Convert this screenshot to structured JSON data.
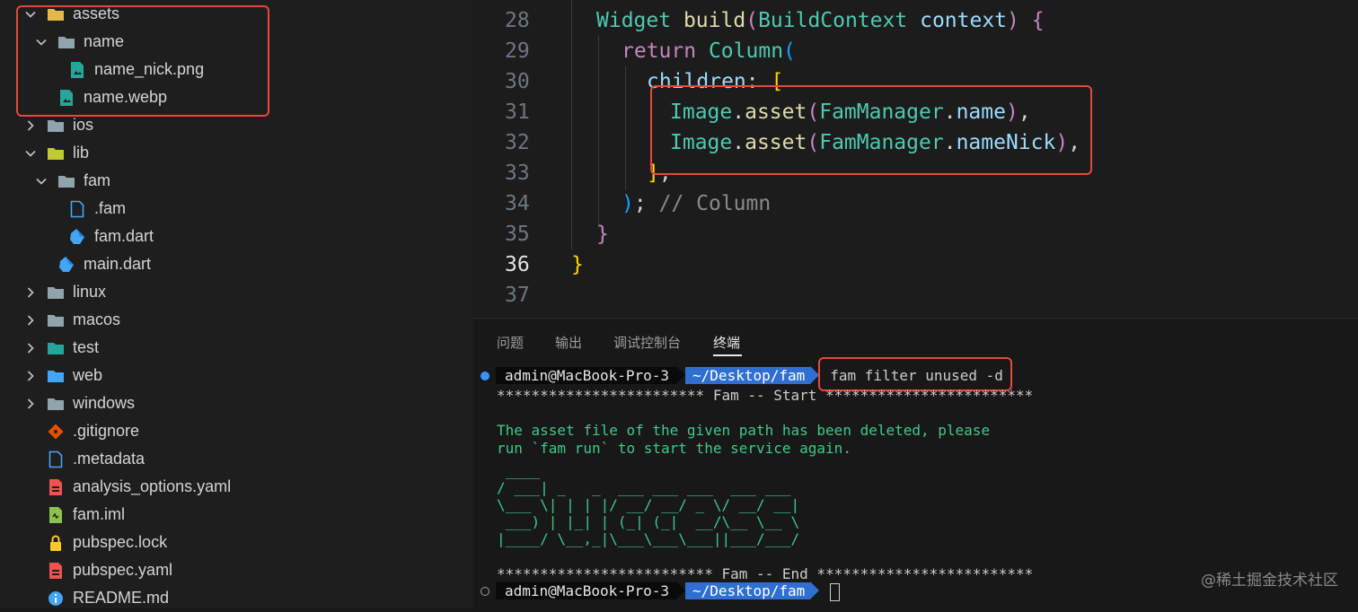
{
  "explorer": {
    "items": [
      {
        "label": "assets",
        "type": "folder",
        "expanded": true,
        "icon": "assets-folder-icon"
      },
      {
        "label": "name",
        "type": "folder",
        "expanded": true,
        "icon": "folder-icon"
      },
      {
        "label": "name_nick.png",
        "type": "file",
        "icon": "image-file-icon"
      },
      {
        "label": "name.webp",
        "type": "file",
        "icon": "image-file-icon"
      },
      {
        "label": "ios",
        "type": "folder",
        "expanded": false,
        "icon": "ios-folder-icon"
      },
      {
        "label": "lib",
        "type": "folder",
        "expanded": true,
        "icon": "lib-folder-icon"
      },
      {
        "label": "fam",
        "type": "folder",
        "expanded": true,
        "icon": "folder-icon"
      },
      {
        "label": ".fam",
        "type": "file",
        "icon": "file-icon"
      },
      {
        "label": "fam.dart",
        "type": "file",
        "icon": "dart-file-icon"
      },
      {
        "label": "main.dart",
        "type": "file",
        "icon": "dart-file-icon"
      },
      {
        "label": "linux",
        "type": "folder",
        "expanded": false,
        "icon": "folder-icon"
      },
      {
        "label": "macos",
        "type": "folder",
        "expanded": false,
        "icon": "folder-icon"
      },
      {
        "label": "test",
        "type": "folder",
        "expanded": false,
        "icon": "test-folder-icon"
      },
      {
        "label": "web",
        "type": "folder",
        "expanded": false,
        "icon": "web-folder-icon"
      },
      {
        "label": "windows",
        "type": "folder",
        "expanded": false,
        "icon": "folder-icon"
      },
      {
        "label": ".gitignore",
        "type": "file",
        "icon": "git-icon"
      },
      {
        "label": ".metadata",
        "type": "file",
        "icon": "file-icon"
      },
      {
        "label": "analysis_options.yaml",
        "type": "file",
        "icon": "yaml-file-icon"
      },
      {
        "label": "fam.iml",
        "type": "file",
        "icon": "iml-file-icon"
      },
      {
        "label": "pubspec.lock",
        "type": "file",
        "icon": "lock-icon"
      },
      {
        "label": "pubspec.yaml",
        "type": "file",
        "icon": "yaml-file-icon"
      },
      {
        "label": "README.md",
        "type": "file",
        "icon": "info-icon"
      }
    ]
  },
  "editor": {
    "line_numbers": [
      "28",
      "29",
      "30",
      "31",
      "32",
      "33",
      "34",
      "35",
      "36",
      "37"
    ],
    "active_line": "36",
    "code": {
      "l28": {
        "t1": "Widget",
        "t2": "build",
        "t3": "(",
        "t4": "BuildContext",
        "t5": "context",
        "t6": ")",
        "t7": "{"
      },
      "l29": {
        "t1": "return",
        "t2": "Column",
        "t3": "("
      },
      "l30": {
        "t1": "children",
        "t2": ":",
        "t3": "["
      },
      "l31": {
        "t1": "Image",
        "t2": ".",
        "t3": "asset",
        "t4": "(",
        "t5": "FamManager",
        "t6": ".",
        "t7": "name",
        "t8": ")",
        "t9": ","
      },
      "l32": {
        "t1": "Image",
        "t2": ".",
        "t3": "asset",
        "t4": "(",
        "t5": "FamManager",
        "t6": ".",
        "t7": "nameNick",
        "t8": ")",
        "t9": ","
      },
      "l33": {
        "t1": "]",
        "t2": ","
      },
      "l34": {
        "t1": ")",
        "t2": ";",
        "t3": "// Column"
      },
      "l35": {
        "t1": "}"
      },
      "l36": {
        "t1": "}"
      }
    }
  },
  "panel": {
    "tabs": [
      "问题",
      "输出",
      "调试控制台",
      "终端"
    ],
    "active_tab": "终端",
    "terminal": {
      "prompt_user": "admin@MacBook-Pro-3",
      "prompt_path": "~/Desktop/fam",
      "command": "fam filter unused -d",
      "start_banner": "************************ Fam -- Start ************************",
      "message_line1": "The asset file of the given path has been deleted, please",
      "message_line2": "run `fam run` to start the service again.",
      "ascii_art": " ____\n/ ___| _   _  ___ ___ ___  ___ ___\n\\___ \\| | | |/ __/ __/ _ \\/ __/ __|\n ___) | |_| | (_| (_|  __/\\__ \\__ \\\n|____/ \\__,_|\\___\\___\\___||___/___/",
      "end_banner": "************************* Fam -- End *************************"
    },
    "watermark": "@稀土掘金技术社区"
  },
  "colors": {
    "highlight_box": "#e8483b",
    "prompt_path_bg": "#2f6fd1",
    "success_green": "#3fc98a"
  }
}
